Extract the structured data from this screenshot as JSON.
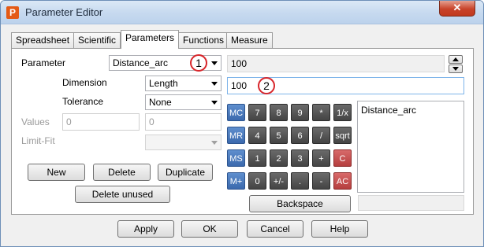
{
  "window": {
    "title": "Parameter Editor",
    "app_icon": "P",
    "close_symbol": "✕"
  },
  "tabs": [
    "Spreadsheet",
    "Scientific",
    "Parameters",
    "Functions",
    "Measure"
  ],
  "active_tab": "Parameters",
  "form": {
    "parameter_label": "Parameter",
    "parameter_value": "Distance_arc",
    "dimension_label": "Dimension",
    "dimension_value": "Length",
    "tolerance_label": "Tolerance",
    "tolerance_value": "None",
    "values_label": "Values",
    "values_min": "0",
    "values_max": "0",
    "limitfit_label": "Limit-Fit",
    "limitfit_value": ""
  },
  "expression": {
    "result": "100",
    "input": "100"
  },
  "callouts": {
    "one": "1",
    "two": "2"
  },
  "buttons": {
    "new": "New",
    "delete": "Delete",
    "duplicate": "Duplicate",
    "delete_unused": "Delete unused",
    "backspace": "Backspace"
  },
  "keypad": {
    "row1": [
      "MC",
      "7",
      "8",
      "9",
      "*",
      "1/x"
    ],
    "row2": [
      "MR",
      "4",
      "5",
      "6",
      "/",
      "sqrt"
    ],
    "row3": [
      "MS",
      "1",
      "2",
      "3",
      "+",
      "C"
    ],
    "row4": [
      "M+",
      "0",
      "+/-",
      ".",
      "-",
      "AC"
    ]
  },
  "list": {
    "items": [
      "Distance_arc"
    ]
  },
  "footer": {
    "apply": "Apply",
    "ok": "OK",
    "cancel": "Cancel",
    "help": "Help"
  },
  "colors": {
    "memory_key": "#4a7bc0",
    "digit_key": "#555555",
    "clear_key": "#c44b4b",
    "callout_ring": "#d8262b",
    "title_bar": "#c6d9ef"
  }
}
